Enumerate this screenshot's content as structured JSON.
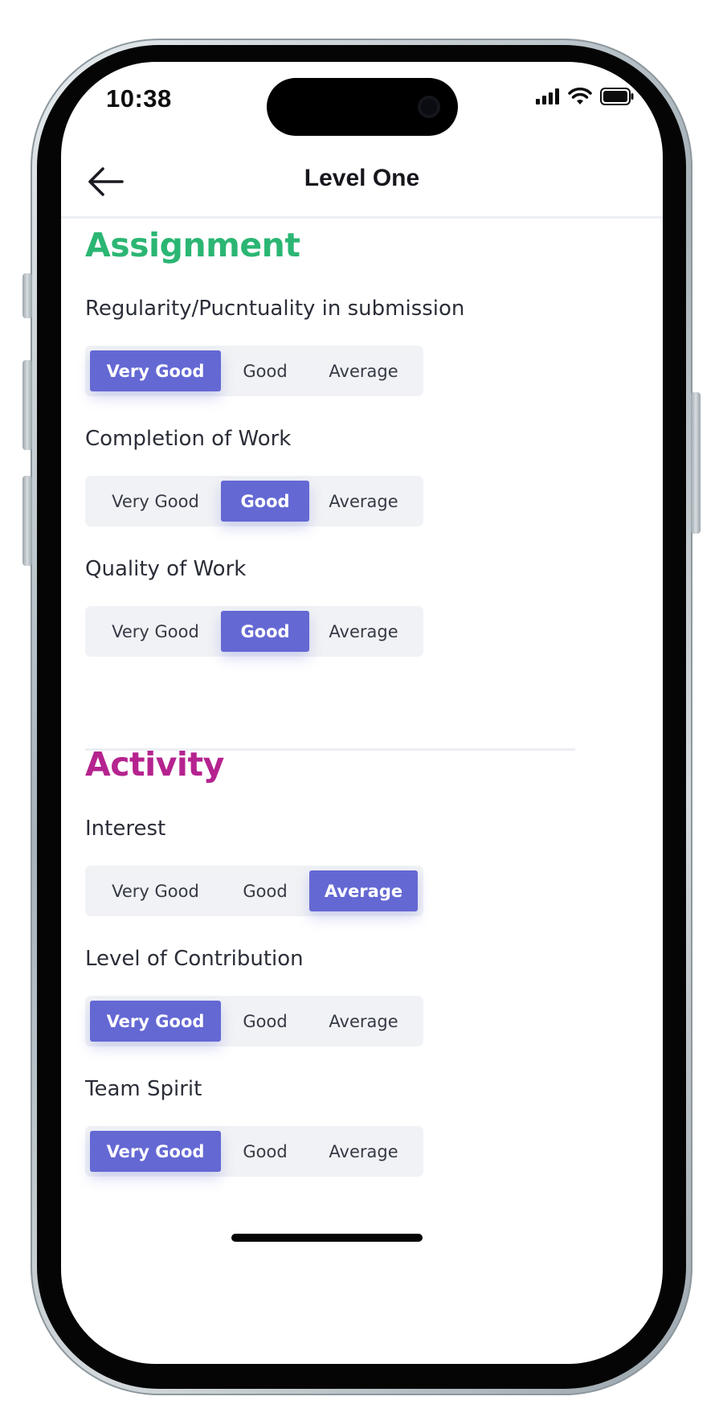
{
  "status_bar": {
    "time": "10:38",
    "icons": [
      "signal-icon",
      "wifi-icon",
      "battery-icon"
    ]
  },
  "header": {
    "title": "Level One",
    "back_icon": "back-arrow-icon"
  },
  "options": [
    "Very Good",
    "Good",
    "Average"
  ],
  "colors": {
    "assignment": "#2bb673",
    "activity": "#b5238f",
    "accent": "#6468d3",
    "segment_bg": "#f0f2f5"
  },
  "sections": [
    {
      "title": "Assignment",
      "questions": [
        {
          "label": "Regularity/Pucntuality in submission",
          "selected": "Very Good"
        },
        {
          "label": "Completion of Work",
          "selected": "Good"
        },
        {
          "label": "Quality of Work",
          "selected": "Good"
        }
      ]
    },
    {
      "title": "Activity",
      "questions": [
        {
          "label": "Interest",
          "selected": "Average"
        },
        {
          "label": "Level of Contribution",
          "selected": "Very Good"
        },
        {
          "label": "Team Spirit",
          "selected": "Very Good"
        }
      ]
    }
  ]
}
